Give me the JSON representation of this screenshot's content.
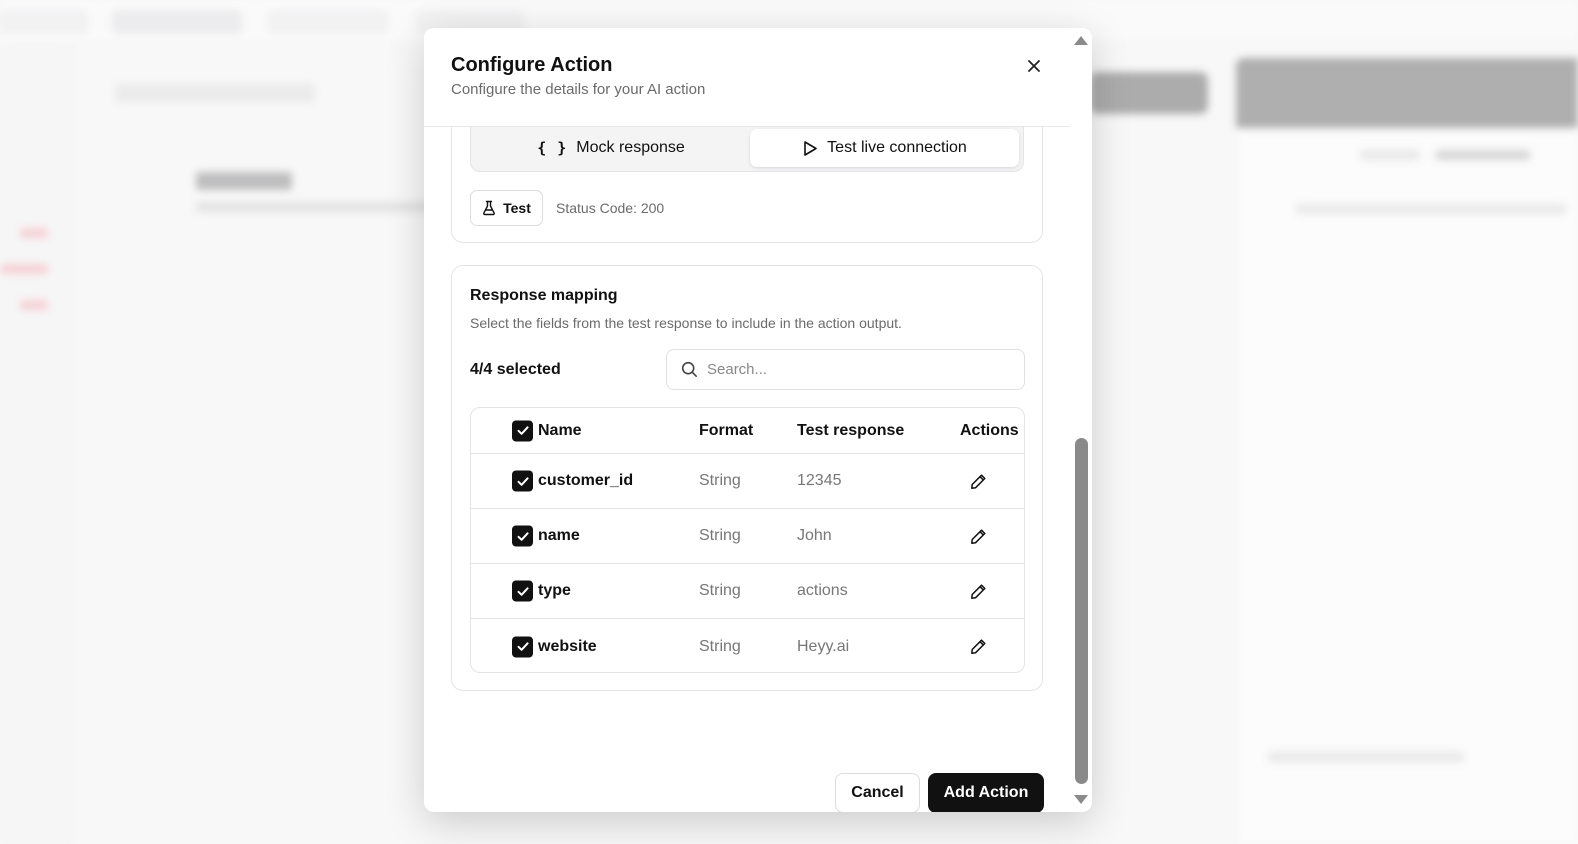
{
  "modal": {
    "title": "Configure Action",
    "subtitle": "Configure the details for your AI action",
    "close_icon": "close-icon"
  },
  "test_mode": {
    "options": [
      {
        "label": "Mock response",
        "icon": "braces-icon",
        "glyph": "{ }",
        "selected": false
      },
      {
        "label": "Test live connection",
        "icon": "play-icon",
        "selected": true
      }
    ],
    "test_button_label": "Test",
    "test_button_icon": "flask-icon",
    "status_text": "Status Code: 200"
  },
  "response_mapping": {
    "title": "Response mapping",
    "description": "Select the fields from the test response to include in the action output.",
    "selected_count": "4/4 selected",
    "search_placeholder": "Search...",
    "columns": [
      "Name",
      "Format",
      "Test response",
      "Actions"
    ],
    "rows": [
      {
        "name": "customer_id",
        "format": "String",
        "response": "12345",
        "checked": true
      },
      {
        "name": "name",
        "format": "String",
        "response": "John",
        "checked": true
      },
      {
        "name": "type",
        "format": "String",
        "response": "actions",
        "checked": true
      },
      {
        "name": "website",
        "format": "String",
        "response": "Heyy.ai",
        "checked": true
      }
    ]
  },
  "footer": {
    "cancel_label": "Cancel",
    "add_label": "Add Action"
  },
  "colors": {
    "primary": "#111111",
    "muted_text": "#6b6b6b",
    "border": "#e4e4e7"
  }
}
